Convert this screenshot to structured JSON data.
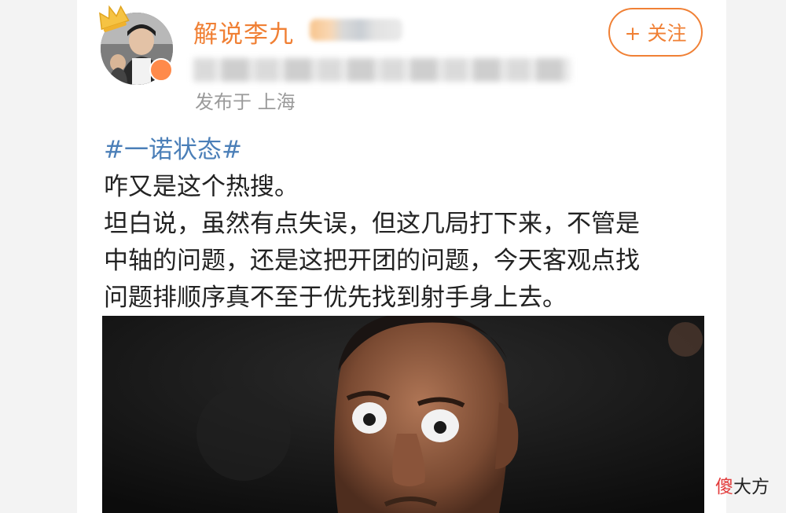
{
  "post": {
    "author_name": "解说李九",
    "location": "发布于 上海",
    "follow_label": "+ 关注",
    "hashtag": "#一诺状态#",
    "lines": [
      "咋又是这个热搜。",
      "坦白说，虽然有点失误，但这几局打下来，不管是",
      "中轴的问题，还是这把开团的问题，今天客观点找",
      "问题排顺序真不至于优先找到射手身上去。"
    ]
  },
  "watermark": {
    "red": "傻",
    "rest": "大方"
  },
  "colors": {
    "accent_orange": "#f08035",
    "hashtag_blue": "#4b7fb8",
    "text": "#222222",
    "muted": "#9a9a9a"
  },
  "icons": {
    "crown": "crown-icon",
    "vip_badge": "vip-badge-icon"
  }
}
